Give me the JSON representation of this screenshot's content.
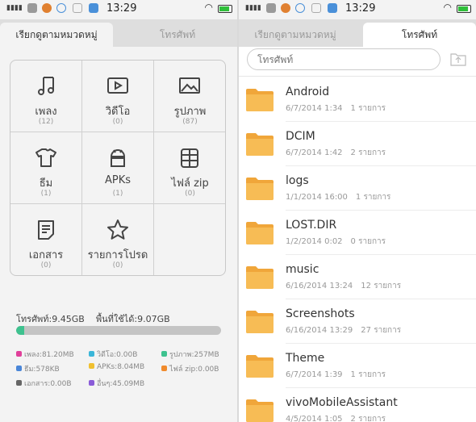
{
  "status_bar": {
    "time": "13:29"
  },
  "left": {
    "tabs": {
      "categories": "เรียกดูตามหมวดหมู่",
      "phone": "โทรศัพท์"
    },
    "categories": [
      {
        "label": "เพลง",
        "count": "(12)",
        "icon": "music-note-icon"
      },
      {
        "label": "วิดีโอ",
        "count": "(0)",
        "icon": "video-play-icon"
      },
      {
        "label": "รูปภาพ",
        "count": "(87)",
        "icon": "image-icon"
      },
      {
        "label": "ธีม",
        "count": "(1)",
        "icon": "tshirt-icon"
      },
      {
        "label": "APKs",
        "count": "(1)",
        "icon": "android-icon"
      },
      {
        "label": "ไฟล์ zip",
        "count": "(0)",
        "icon": "zip-archive-icon"
      },
      {
        "label": "เอกสาร",
        "count": "(0)",
        "icon": "document-icon"
      },
      {
        "label": "รายการโปรด",
        "count": "(0)",
        "icon": "star-icon"
      }
    ],
    "storage": {
      "phone_label": "โทรศัพท์:",
      "phone_value": "9.45GB",
      "free_label": "พื้นที่ใช้ได้:",
      "free_value": "9.07GB",
      "used_fraction": 0.04
    },
    "legend": [
      {
        "text": "เพลง:81.20MB",
        "color": "#e0409a"
      },
      {
        "text": "วิดีโอ:0.00B",
        "color": "#3bb6d8"
      },
      {
        "text": "รูปภาพ:257MB",
        "color": "#3ec28f"
      },
      {
        "text": "ธีม:578KB",
        "color": "#4a86d8"
      },
      {
        "text": "APKs:8.04MB",
        "color": "#f0c030"
      },
      {
        "text": "ไฟล์ zip:0.00B",
        "color": "#f08a2c"
      },
      {
        "text": "เอกสาร:0.00B",
        "color": "#666666"
      },
      {
        "text": "อื่นๆ:45.09MB",
        "color": "#8a5cd8"
      }
    ]
  },
  "right": {
    "tabs": {
      "categories": "เรียกดูตามหมวดหมู่",
      "phone": "โทรศัพท์"
    },
    "search": {
      "placeholder": "โทรศัพท์"
    },
    "items_label": "รายการ",
    "folders": [
      {
        "name": "Android",
        "date": "6/7/2014 1:34",
        "count": "1"
      },
      {
        "name": "DCIM",
        "date": "6/7/2014 1:42",
        "count": "2"
      },
      {
        "name": "logs",
        "date": "1/1/2014 16:00",
        "count": "1"
      },
      {
        "name": "LOST.DIR",
        "date": "1/2/2014 0:02",
        "count": "0"
      },
      {
        "name": "music",
        "date": "6/16/2014 13:24",
        "count": "12"
      },
      {
        "name": "Screenshots",
        "date": "6/16/2014 13:29",
        "count": "27"
      },
      {
        "name": "Theme",
        "date": "6/7/2014 1:39",
        "count": "1"
      },
      {
        "name": "vivoMobileAssistant",
        "date": "4/5/2014 1:05",
        "count": "2"
      }
    ]
  }
}
